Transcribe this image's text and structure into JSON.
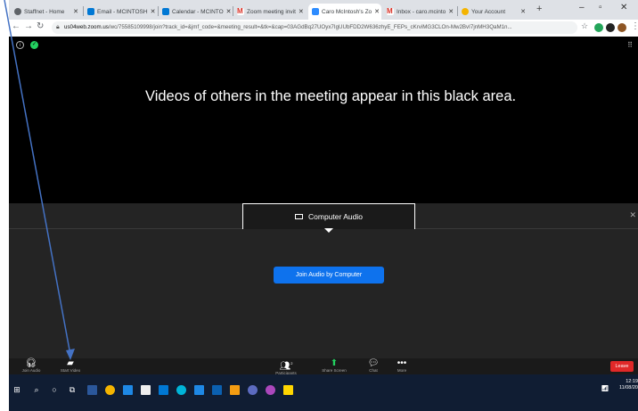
{
  "browser": {
    "tabs": [
      {
        "label": "Staffnet - Home",
        "color": "#5f6368"
      },
      {
        "label": "Email - MCINTOSH",
        "color": "#0078d4"
      },
      {
        "label": "Calendar - MCINTO",
        "color": "#0078d4"
      },
      {
        "label": "Zoom meeting invit",
        "color": "#d93025"
      },
      {
        "label": "Caro McIntosh's Zo",
        "color": "#2d8cff",
        "active": true
      },
      {
        "label": "Inbox - caro.mcinto",
        "color": "#d93025"
      },
      {
        "label": "Your Account",
        "color": "#f4b400"
      }
    ],
    "new_tab_icon": "plus-icon",
    "url_domain": "us04web.zoom.us",
    "url_path": "/wc/75585109998/join?track_id=&jmf_code=&meeting_result=&tk=&cap=03AGdBq27UOyx7IgUUbFDD2W636zhyE_FEPs_cKrviMG3CLOn-Mw2BvI7jnMH3QaM1n..."
  },
  "zoom": {
    "annotation": "Videos of others in the meeting appear in this black area.",
    "audio_tab_label": "Computer Audio",
    "join_audio_label": "Join Audio by Computer",
    "toolbar": {
      "join_audio": "Join Audio",
      "start_video": "Start Video",
      "participants": "Participants",
      "participants_count": "2",
      "share_screen": "Share Screen",
      "chat": "Chat",
      "more": "More",
      "leave": "Leave"
    },
    "colors": {
      "accent": "#0e72ed",
      "leave": "#e02828",
      "share": "#23d160"
    }
  },
  "taskbar": {
    "time": "12:19",
    "date": "11/08/20"
  },
  "annotation_arrow": {
    "color": "#4472c4"
  }
}
